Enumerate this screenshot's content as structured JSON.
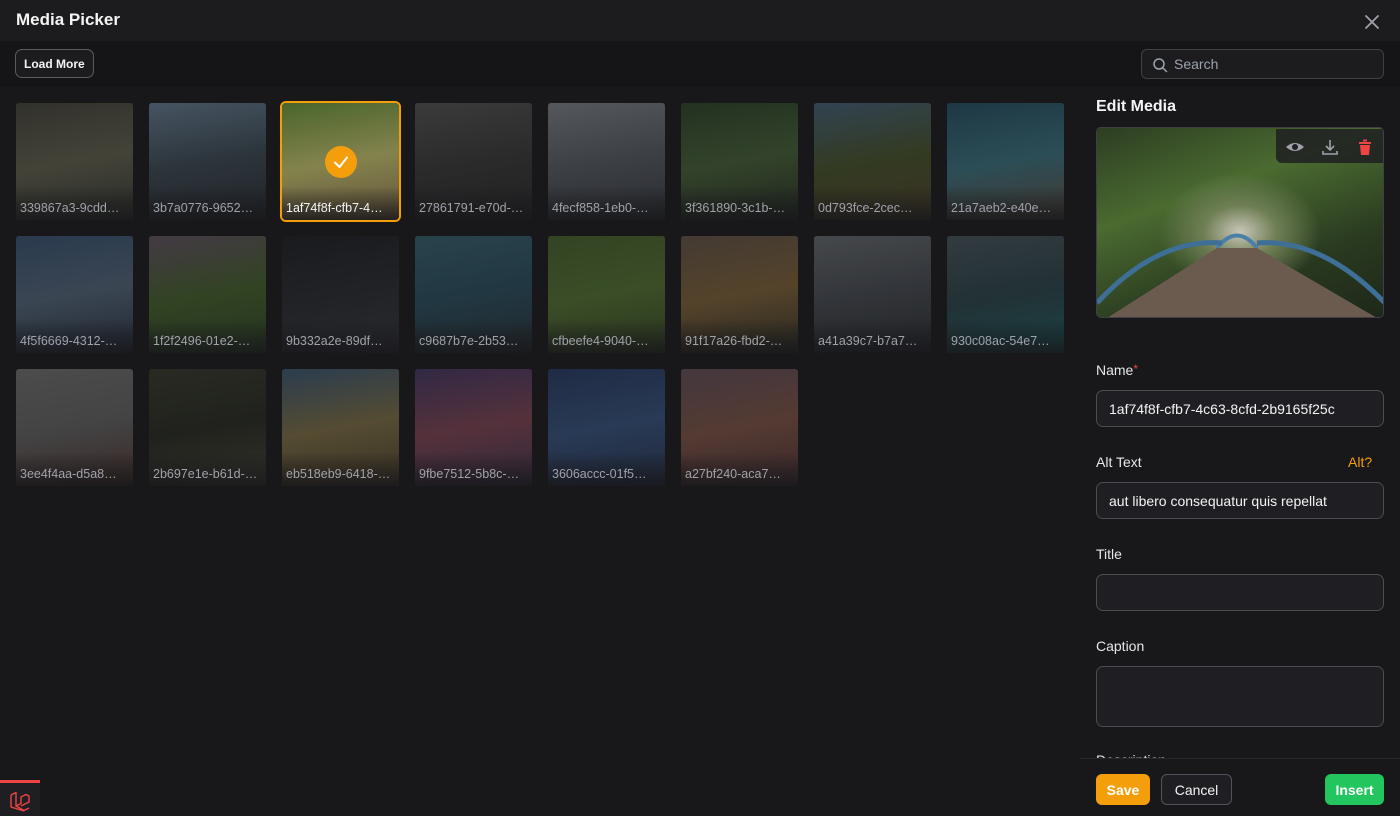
{
  "header": {
    "title": "Media Picker"
  },
  "toolbar": {
    "load_more_label": "Load More",
    "search_placeholder": "Search"
  },
  "media": [
    {
      "name": "339867a3-9cdd…",
      "colors": [
        "#4a4a3e",
        "#6b6a55",
        "#3a3f33"
      ],
      "selected": false
    },
    {
      "name": "3b7a0776-9652…",
      "colors": [
        "#6f8aa0",
        "#41505a",
        "#2b3138"
      ],
      "selected": false
    },
    {
      "name": "1af74f8f-cfb7-4…",
      "colors": [
        "#4e6b2e",
        "#8b8a52",
        "#6b5b3e"
      ],
      "selected": true
    },
    {
      "name": "27861791-e70d-…",
      "colors": [
        "#5b5b5b",
        "#3e3e3e",
        "#2c2c2c"
      ],
      "selected": false
    },
    {
      "name": "4fecf858-1eb0-…",
      "colors": [
        "#8a8f96",
        "#5e646b",
        "#3c4046"
      ],
      "selected": false
    },
    {
      "name": "3f361890-3c1b-…",
      "colors": [
        "#2f4a2a",
        "#4d6b3c",
        "#2a3526"
      ],
      "selected": false
    },
    {
      "name": "0d793fce-2cec…",
      "colors": [
        "#4b6a83",
        "#4d5b2c",
        "#5b4b2e"
      ],
      "selected": false
    },
    {
      "name": "21a7aeb2-e40e…",
      "colors": [
        "#27566b",
        "#3f7d8b",
        "#6b5a4a"
      ],
      "selected": false
    },
    {
      "name": "4f5f6669-4312-…",
      "colors": [
        "#3c5b7c",
        "#5b6f85",
        "#2b3a4a"
      ],
      "selected": false
    },
    {
      "name": "1f2f2496-01e2-…",
      "colors": [
        "#6b5a6b",
        "#4b6b2e",
        "#34502a"
      ],
      "selected": false
    },
    {
      "name": "9b332a2e-89df…",
      "colors": [
        "#1f2126",
        "#2c2f35",
        "#3a3d44"
      ],
      "selected": false
    },
    {
      "name": "c9687b7e-2b53…",
      "colors": [
        "#3b6a7a",
        "#2c5566",
        "#2c3a3f"
      ],
      "selected": false
    },
    {
      "name": "cfbeefe4-9040-…",
      "colors": [
        "#4d6b2e",
        "#5a7d35",
        "#3d5526"
      ],
      "selected": false
    },
    {
      "name": "91f17a26-fbd2-…",
      "colors": [
        "#6b5a4a",
        "#8a6b3c",
        "#3d3a2a"
      ],
      "selected": false
    },
    {
      "name": "a41a39c7-b7a7…",
      "colors": [
        "#6e7378",
        "#4b5056",
        "#2f3236"
      ],
      "selected": false
    },
    {
      "name": "930c08ac-54e7…",
      "colors": [
        "#4b5b63",
        "#2e4a4f",
        "#1f6a6b"
      ],
      "selected": false
    },
    {
      "name": "3ee4f4aa-d5a8…",
      "colors": [
        "#7a7a7a",
        "#6b6b6b",
        "#5a3a33"
      ],
      "selected": false
    },
    {
      "name": "2b697e1e-b61d-…",
      "colors": [
        "#3a3d2e",
        "#2b2e22",
        "#4a4a3a"
      ],
      "selected": false
    },
    {
      "name": "eb518eb9-6418-…",
      "colors": [
        "#3f5f7c",
        "#8a7a4a",
        "#5a4a2e"
      ],
      "selected": false
    },
    {
      "name": "9fbe7512-5b8c-…",
      "colors": [
        "#4a3a6b",
        "#8a4a5a",
        "#4a3a5a"
      ],
      "selected": false
    },
    {
      "name": "3606accc-01f5…",
      "colors": [
        "#2a3f6b",
        "#3a5a8a",
        "#2b3a5a"
      ],
      "selected": false
    },
    {
      "name": "a27bf240-aca7…",
      "colors": [
        "#6b5560",
        "#8a5a4a",
        "#5a3a3a"
      ],
      "selected": false
    }
  ],
  "editor": {
    "title": "Edit Media",
    "name_label": "Name",
    "required_mark": "*",
    "name_value": "1af74f8f-cfb7-4c63-8cfd-2b9165f25c",
    "alt_label": "Alt Text",
    "alt_link": "Alt?",
    "alt_value": "aut libero consequatur quis repellat",
    "title_label": "Title",
    "title_value": "",
    "caption_label": "Caption",
    "caption_value": "",
    "description_label": "Description"
  },
  "footer": {
    "save_label": "Save",
    "cancel_label": "Cancel",
    "insert_label": "Insert"
  },
  "colors": {
    "accent": "#f59e0b",
    "insert": "#22c55e",
    "danger": "#ef4444"
  }
}
